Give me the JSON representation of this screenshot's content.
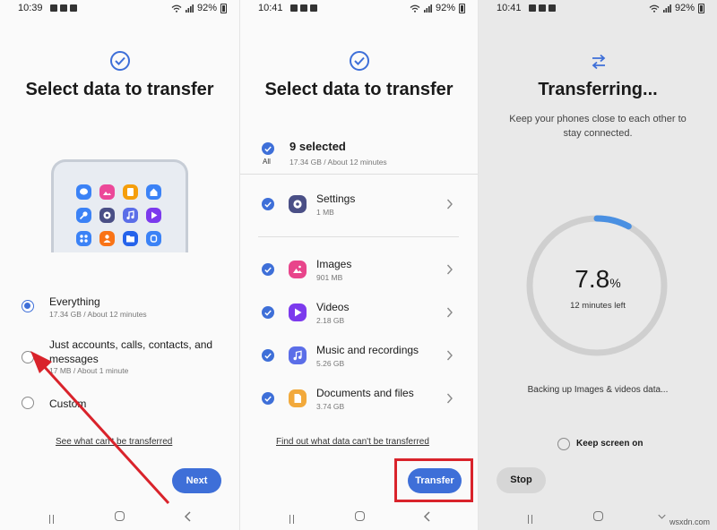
{
  "panel1": {
    "status": {
      "time": "10:39",
      "battery": "92%"
    },
    "title": "Select data to transfer",
    "options": [
      {
        "label": "Everything",
        "sub": "17.34 GB / About 12 minutes",
        "selected": true
      },
      {
        "label_line1": "Just accounts, calls, contacts, and",
        "label_line2": "messages",
        "sub": "17 MB / About 1 minute",
        "selected": false
      },
      {
        "label": "Custom",
        "selected": false
      }
    ],
    "link": "See what can't be transferred",
    "next_button": "Next"
  },
  "panel2": {
    "status": {
      "time": "10:41",
      "battery": "92%"
    },
    "title": "Select data to transfer",
    "selected_count": "9 selected",
    "selected_sub": "17.34 GB / About 12 minutes",
    "all_label": "All",
    "items": [
      {
        "label": "Settings",
        "size": "1 MB",
        "icon": "settings-icon",
        "color": "#4a4f86"
      },
      {
        "label": "Images",
        "size": "901 MB",
        "icon": "images-icon",
        "color": "#e8458b"
      },
      {
        "label": "Videos",
        "size": "2.18 GB",
        "icon": "videos-icon",
        "color": "#7c3aed"
      },
      {
        "label": "Music and recordings",
        "size": "5.26 GB",
        "icon": "music-icon",
        "color": "#5b6ee8"
      },
      {
        "label": "Documents and files",
        "size": "3.74 GB",
        "icon": "documents-icon",
        "color": "#f2a93b"
      }
    ],
    "link": "Find out what data can't be transferred",
    "transfer_button": "Transfer"
  },
  "panel3": {
    "status": {
      "time": "10:41",
      "battery": "92%"
    },
    "title": "Transferring...",
    "description_line1": "Keep your phones close to each other to",
    "description_line2": "stay connected.",
    "progress_percent": 7.8,
    "percent_value": "7.8",
    "percent_unit": "%",
    "time_left": "12 minutes left",
    "backup_status": "Backing up Images & videos data...",
    "keep_screen_on": "Keep screen on",
    "stop_button": "Stop",
    "watermark": "wsxdn.com"
  },
  "colors": {
    "accent": "#3e6fd8",
    "highlight": "#d9232b",
    "ring_track": "#cfcfcf",
    "ring_fill": "#4a90e2"
  }
}
